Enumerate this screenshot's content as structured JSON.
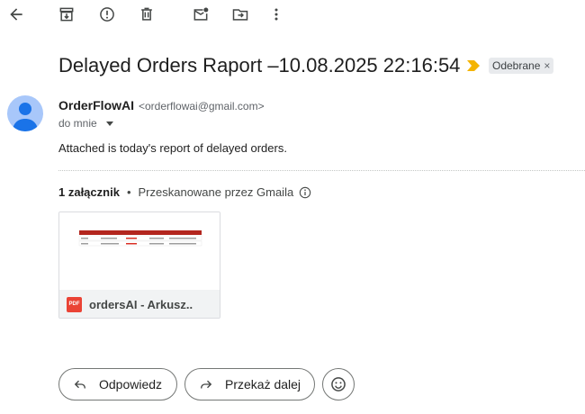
{
  "toolbar": {
    "icons": [
      "back-arrow-icon",
      "archive-icon",
      "report-spam-icon",
      "delete-icon",
      "mark-unread-icon",
      "move-to-icon",
      "more-options-icon"
    ]
  },
  "email": {
    "subject": "Delayed Orders Raport –10.08.2025 22:16:54",
    "label": "Odebrane",
    "label_remove": "×",
    "sender_name": "OrderFlowAI",
    "sender_email": "<orderflowai@gmail.com>",
    "recipient": "do mnie",
    "body": "Attached is today's report of delayed orders."
  },
  "attachments": {
    "count_label": "1 załącznik",
    "separator": "•",
    "scan_label": "Przeskanowane przez Gmaila",
    "file": {
      "type_badge": "PDF",
      "name": "ordersAI - Arkusz..."
    }
  },
  "actions": {
    "reply": "Odpowiedz",
    "forward": "Przekaż dalej"
  },
  "colors": {
    "pdf_red": "#ea4335",
    "importance_yellow": "#f4b400",
    "avatar_bg": "#a8c7fa",
    "avatar_fg": "#1a73e8",
    "thumb_header": "#b3261e"
  }
}
